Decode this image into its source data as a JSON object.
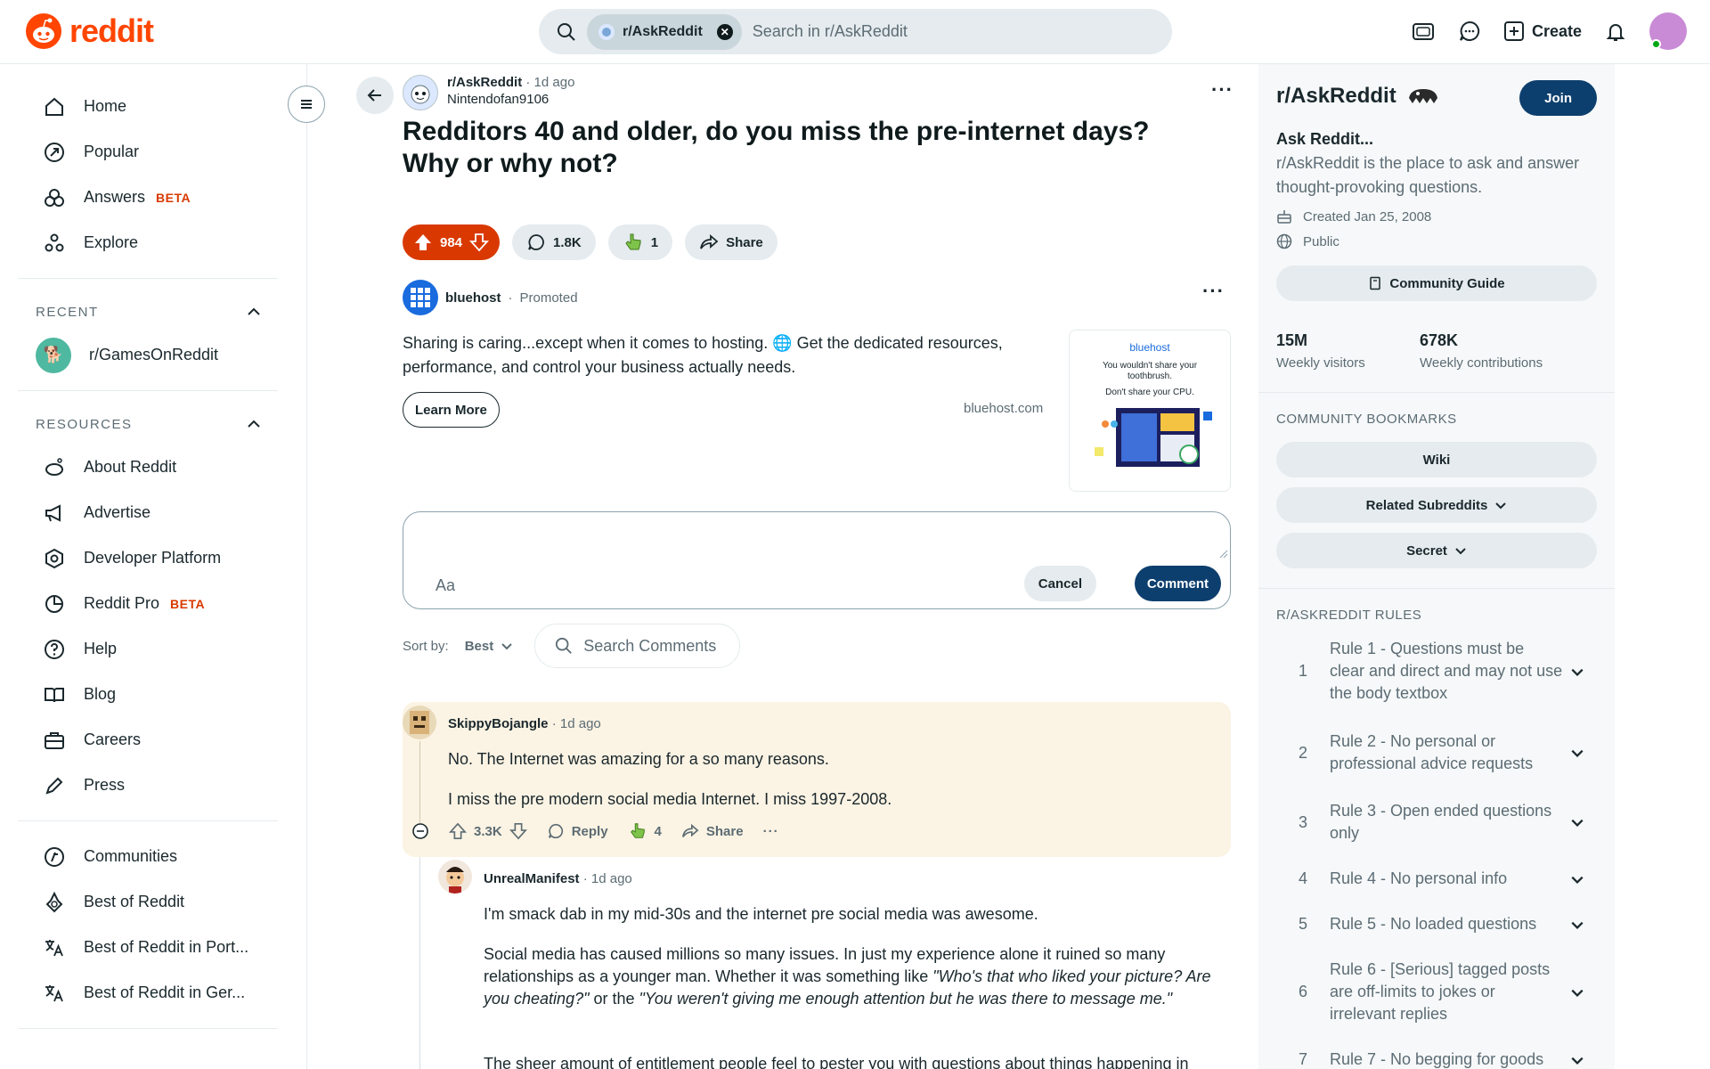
{
  "header": {
    "logo_text": "reddit",
    "search_chip": "r/AskReddit",
    "search_placeholder": "Search in r/AskReddit",
    "create_label": "Create"
  },
  "sidebar": {
    "primary": [
      {
        "label": "Home",
        "icon": "home-icon"
      },
      {
        "label": "Popular",
        "icon": "popular-icon"
      },
      {
        "label": "Answers",
        "icon": "answers-icon",
        "badge": "BETA"
      },
      {
        "label": "Explore",
        "icon": "explore-icon"
      }
    ],
    "recent_title": "RECENT",
    "recent": [
      {
        "label": "r/GamesOnReddit"
      }
    ],
    "resources_title": "RESOURCES",
    "resources": [
      {
        "label": "About Reddit"
      },
      {
        "label": "Advertise"
      },
      {
        "label": "Developer Platform"
      },
      {
        "label": "Reddit Pro",
        "badge": "BETA"
      },
      {
        "label": "Help"
      },
      {
        "label": "Blog"
      },
      {
        "label": "Careers"
      },
      {
        "label": "Press"
      }
    ],
    "more": [
      {
        "label": "Communities"
      },
      {
        "label": "Best of Reddit"
      },
      {
        "label": "Best of Reddit in Port..."
      },
      {
        "label": "Best of Reddit in Ger..."
      }
    ]
  },
  "post": {
    "subreddit": "r/AskReddit",
    "time": "1d ago",
    "author": "Nintendofan9106",
    "title": "Redditors 40 and older, do you miss the pre-internet days? Why or why not?",
    "votes": "984",
    "comments": "1.8K",
    "awards": "1",
    "share": "Share"
  },
  "ad": {
    "advertiser": "bluehost",
    "promoted": "Promoted",
    "text": "Sharing is caring...except when it comes to hosting. 🌐 Get the dedicated resources, performance, and control your business actually needs.",
    "cta": "Learn More",
    "domain": "bluehost.com",
    "img_brand": "bluehost",
    "img_line1": "You wouldn't share your toothbrush.",
    "img_line2": "Don't share your CPU."
  },
  "composer": {
    "aa": "Aa",
    "cancel": "Cancel",
    "submit": "Comment"
  },
  "sort": {
    "label": "Sort by:",
    "value": "Best",
    "search": "Search Comments"
  },
  "comments": [
    {
      "author": "SkippyBojangle",
      "time": "1d ago",
      "p1": "No. The Internet was amazing for a so many reasons.",
      "p2": "I miss the pre modern social media Internet. I miss 1997-2008.",
      "votes": "3.3K",
      "reply": "Reply",
      "awards": "4",
      "share": "Share"
    },
    {
      "author": "UnrealManifest",
      "time": "1d ago",
      "p1": "I'm smack dab in my mid-30s and the internet pre social media was awesome.",
      "p2a": "Social media has caused millions so many issues. In just my experience alone it ruined so many relationships as a younger man. Whether it was something like ",
      "p2b": "\"Who's that who liked your picture? Are you cheating?\"",
      "p2c": " or the ",
      "p2d": "\"You weren't giving me enough attention but he was there to message me.\"",
      "p3": "The sheer amount of entitlement people feel to pester you with questions about things happening in"
    }
  ],
  "community": {
    "name": "r/AskReddit",
    "join": "Join",
    "desc_title": "Ask Reddit...",
    "desc": "r/AskReddit is the place to ask and answer thought-provoking questions.",
    "created": "Created Jan 25, 2008",
    "visibility": "Public",
    "guide": "Community Guide",
    "visitors": "15M",
    "visitors_label": "Weekly visitors",
    "contributions": "678K",
    "contributions_label": "Weekly contributions",
    "bookmarks_title": "COMMUNITY BOOKMARKS",
    "bookmarks": [
      "Wiki",
      "Related Subreddits",
      "Secret"
    ],
    "rules_title": "R/ASKREDDIT RULES",
    "rules": [
      {
        "n": "1",
        "t": "Rule 1 - Questions must be clear and direct and may not use the body textbox"
      },
      {
        "n": "2",
        "t": "Rule 2 - No personal or professional advice requests"
      },
      {
        "n": "3",
        "t": "Rule 3 - Open ended questions only"
      },
      {
        "n": "4",
        "t": "Rule 4 - No personal info"
      },
      {
        "n": "5",
        "t": "Rule 5 - No loaded questions"
      },
      {
        "n": "6",
        "t": "Rule 6 - [Serious] tagged posts are off-limits to jokes or irrelevant replies"
      },
      {
        "n": "7",
        "t": "Rule 7 - No begging for goods"
      }
    ]
  },
  "colors": {
    "brand": "#ff4500",
    "upvote_active": "#d93900",
    "join": "#0d3f6e"
  }
}
